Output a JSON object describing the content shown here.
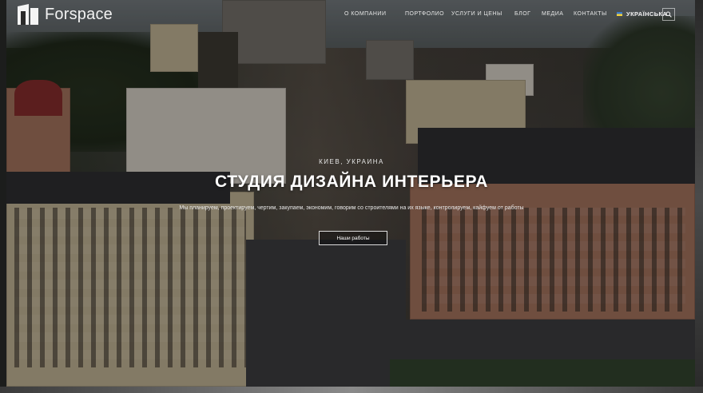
{
  "header": {
    "logo_text": "Forspace",
    "nav": [
      {
        "label": "О компании"
      },
      {
        "label": "Портфолио"
      },
      {
        "label": "Услуги и цены"
      },
      {
        "label": "Блог"
      },
      {
        "label": "Медиа"
      },
      {
        "label": "Контакты"
      }
    ],
    "language": "УКРАЇНСЬКА"
  },
  "hero": {
    "location": "Киев, Украина",
    "title": "СТУДИЯ ДИЗАЙНА ИНТЕРЬЕРА",
    "subtitle": "Мы планируем, проектируем, чертим, закупаем, экономим, говорим со строителями на их языке, контролируем, кайфуем от работы",
    "cta_label": "Наши работы"
  },
  "icons": {
    "logo": "forspace-logo-icon",
    "search": "search-icon",
    "flag": "ukraine-flag-icon"
  },
  "colors": {
    "accent_flag_blue": "#3a78c8",
    "accent_flag_yellow": "#f2d23c"
  }
}
